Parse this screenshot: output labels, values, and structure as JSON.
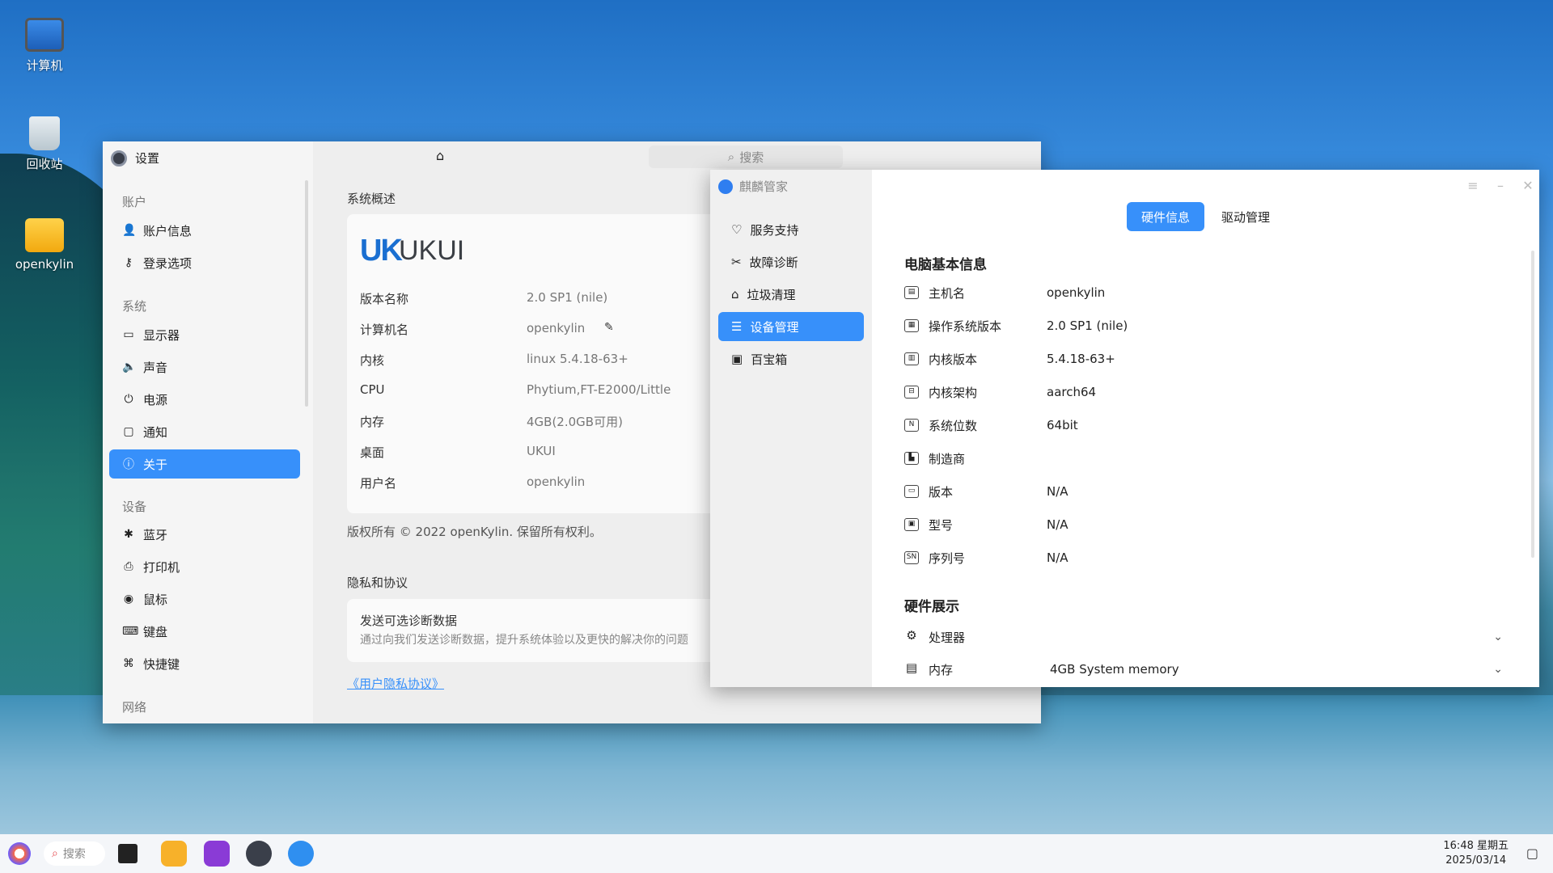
{
  "desktop": {
    "icons": [
      {
        "label": "计算机"
      },
      {
        "label": "回收站"
      },
      {
        "label": "openkylin"
      }
    ]
  },
  "settings": {
    "title": "设置",
    "search_placeholder": "搜索",
    "sidebar": {
      "groups": {
        "account": "账户",
        "system": "系统",
        "device": "设备",
        "network": "网络"
      },
      "items": {
        "account_info": "账户信息",
        "login_options": "登录选项",
        "display": "显示器",
        "sound": "声音",
        "power": "电源",
        "notification": "通知",
        "about": "关于",
        "bluetooth": "蓝牙",
        "printer": "打印机",
        "mouse": "鼠标",
        "keyboard": "键盘",
        "shortcut": "快捷键"
      }
    },
    "overview": {
      "section_title": "系统概述",
      "logo_uk": "UK",
      "logo_ukui": "UKUI",
      "rows": [
        {
          "label": "版本名称",
          "value": "2.0 SP1 (nile)"
        },
        {
          "label": "计算机名",
          "value": "openkylin"
        },
        {
          "label": "内核",
          "value": "linux 5.4.18-63+"
        },
        {
          "label": "CPU",
          "value": "Phytium,FT-E2000/Little"
        },
        {
          "label": "内存",
          "value": "4GB(2.0GB可用)"
        },
        {
          "label": "桌面",
          "value": "UKUI"
        },
        {
          "label": "用户名",
          "value": "openkylin"
        }
      ],
      "copyright": "版权所有 © 2022 openKylin. 保留所有权利。"
    },
    "privacy": {
      "section_title": "隐私和协议",
      "title": "发送可选诊断数据",
      "desc": "通过向我们发送诊断数据，提升系统体验以及更快的解决你的问题",
      "link": "《用户隐私协议》"
    }
  },
  "kylin": {
    "title": "麒麟管家",
    "sidebar": {
      "service": "服务支持",
      "diagnose": "故障诊断",
      "cleanup": "垃圾清理",
      "device": "设备管理",
      "toolbox": "百宝箱"
    },
    "tabs": {
      "hardware": "硬件信息",
      "driver": "驱动管理"
    },
    "basic_title": "电脑基本信息",
    "basic_rows": [
      {
        "label": "主机名",
        "value": "openkylin"
      },
      {
        "label": "操作系统版本",
        "value": "2.0 SP1 (nile)"
      },
      {
        "label": "内核版本",
        "value": "5.4.18-63+"
      },
      {
        "label": "内核架构",
        "value": "aarch64"
      },
      {
        "label": "系统位数",
        "value": "64bit"
      },
      {
        "label": "制造商",
        "value": ""
      },
      {
        "label": "版本",
        "value": "N/A"
      },
      {
        "label": "型号",
        "value": "N/A"
      },
      {
        "label": "序列号",
        "value": "N/A"
      }
    ],
    "hw_title": "硬件展示",
    "hw_rows": [
      {
        "label": "处理器",
        "value": ""
      },
      {
        "label": "内存",
        "value": "4GB System memory"
      }
    ]
  },
  "taskbar": {
    "search": "搜索",
    "time": "16:48 星期五",
    "date": "2025/03/14"
  }
}
